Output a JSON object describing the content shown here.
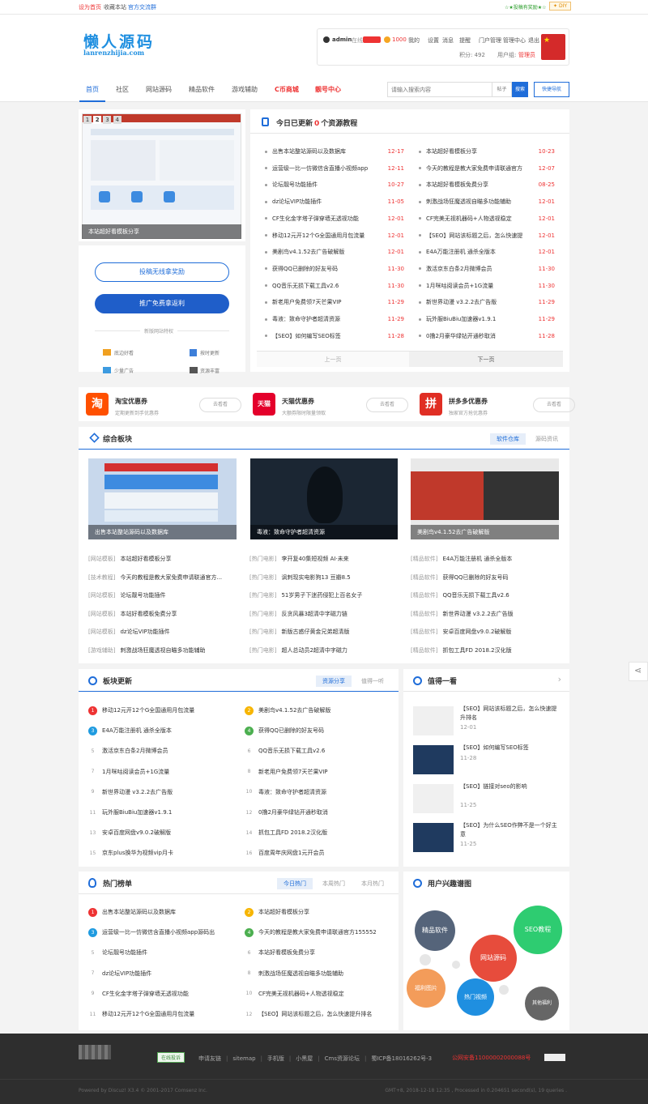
{
  "topbar": {
    "set_home": "设为首页",
    "bookmark": "收藏本站",
    "qq_group": "官方交流群",
    "right_link": "☆★投稿有奖励★☆",
    "diy": "DIY"
  },
  "logo": {
    "text": "懒人源码",
    "domain": "lanrenzhijia.com"
  },
  "user": {
    "name": "admin",
    "status": "在线",
    "points_label": "1000",
    "mine": "我的",
    "settings": "设置",
    "message": "消息",
    "remind": "提醒",
    "portal": "门户管理",
    "admin": "管理中心",
    "logout": "退出",
    "score": "积分: 492",
    "group_label": "用户组:",
    "group": "管理员"
  },
  "nav": {
    "items": [
      "首页",
      "社区",
      "网站源码",
      "精品软件",
      "游戏辅助",
      "C币商城",
      "靓号中心"
    ],
    "search_placeholder": "请输入搜索内容",
    "search_type": "帖子",
    "search_btn": "搜索",
    "quick_nav": "快捷导航"
  },
  "slider": {
    "pages": [
      "1",
      "2",
      "3",
      "4"
    ],
    "caption": "本站超好看模板分享"
  },
  "promo": {
    "btn1": "投稿无线拿奖励",
    "btn2": "推广免费拿返利",
    "features_title": "新版网站特权",
    "features": [
      "底边好看",
      "按时更新",
      "少量广告",
      "资源丰富"
    ]
  },
  "today": {
    "title_pre": "今日已更新",
    "count": "0",
    "title_post": "个资源教程",
    "prev": "上一页",
    "next": "下一页",
    "left": [
      [
        "出售本站整站源码以及数据库",
        "12-17"
      ],
      [
        "运营级一比一仿微信含直播小视频app",
        "12-11"
      ],
      [
        "论坛靓号功能插件",
        "10-27"
      ],
      [
        "dz论坛VIP功能插件",
        "11-05"
      ],
      [
        "CF生化金字塔子弹穿墙无透视功能",
        "12-01"
      ],
      [
        "移动12元开12个G全国通用月包流量",
        "12-01"
      ],
      [
        "美剧鸟v4.1.52去广告破解版",
        "12-01"
      ],
      [
        "获得QQ已删除的好友号码",
        "11-30"
      ],
      [
        "QQ音乐无损下载工具v2.6",
        "11-30"
      ],
      [
        "新老用户免费领7天芒果VIP",
        "11-29"
      ],
      [
        "毒液：致命守护者超清资源",
        "11-29"
      ],
      [
        "【SEO】如何编写SEO标签",
        "11-28"
      ]
    ],
    "right": [
      [
        "本站超好看模板分享",
        "10-23"
      ],
      [
        "今天的教程是教大家免费申请联通官方",
        "12-07"
      ],
      [
        "本站超好看模板免费分享",
        "08-25"
      ],
      [
        "刺激战场狂魔透视自瞄多功能辅助",
        "12-01"
      ],
      [
        "CF完美无视机器码+人物透视稳定",
        "12-01"
      ],
      [
        "【SEO】网站该标题之后，怎么快速提",
        "12-01"
      ],
      [
        "E4A万能注册机 通杀全版本",
        "12-01"
      ],
      [
        "激活京东白条2月微博会员",
        "11-30"
      ],
      [
        "1月咪咕阅读会员+1G流量",
        "11-30"
      ],
      [
        "新世界动漫 v3.2.2去广告版",
        "11-29"
      ],
      [
        "玩外服BiuBiu加速器v1.9.1",
        "11-29"
      ],
      [
        "0撸2月豪华绿钻开通秒取消",
        "11-28"
      ]
    ]
  },
  "coupons": [
    {
      "icon": "淘",
      "name": "淘宝优惠券",
      "sub": "定期更新到手优惠券",
      "btn": "去看看",
      "color": "#ff5000"
    },
    {
      "icon": "天猫",
      "name": "天猫优惠券",
      "sub": "大额券限时限量领取",
      "btn": "去看看",
      "color": "#e4002b"
    },
    {
      "icon": "拼",
      "name": "拼多多优惠券",
      "sub": "独家官方抢优惠券",
      "btn": "去看看",
      "color": "#e02e24"
    }
  ],
  "comp": {
    "title": "综合板块",
    "tabs": [
      "软件仓库",
      "源码资讯"
    ],
    "thumbs": [
      "出售本站整站源码以及数据库",
      "毒液：致命守护者超清资源",
      "美剧鸟v4.1.52去广告破解版"
    ],
    "cols": [
      [
        [
          "[网站模板]",
          "本站超好看模板分享"
        ],
        [
          "[技术教程]",
          "今天的教程是教大家免费申请联通官方..."
        ],
        [
          "[网站模板]",
          "论坛靓号功能插件"
        ],
        [
          "[网站模板]",
          "本站好看模板免费分享"
        ],
        [
          "[网站模板]",
          "dz论坛VIP功能插件"
        ],
        [
          "[游戏辅助]",
          "刺激战场狂魔透视自瞄多功能辅助"
        ]
      ],
      [
        [
          "[热门电影]",
          "李开复40集短视频 AI·未来"
        ],
        [
          "[热门电影]",
          "讽刺现实电影狗13 豆瓣8.5"
        ],
        [
          "[热门电影]",
          "51岁男子下迷药侵犯上百名女子"
        ],
        [
          "[热门电影]",
          "反贪风暴3超清中字磁力链"
        ],
        [
          "[热门电影]",
          "新版古惑仔黄金兄弟超清版"
        ],
        [
          "[热门电影]",
          "超人总动员2超清中字磁力"
        ]
      ],
      [
        [
          "[精品软件]",
          "E4A万能注册机 通杀全版本"
        ],
        [
          "[精品软件]",
          "获得QQ已删除的好友号码"
        ],
        [
          "[精品软件]",
          "QQ音乐无损下载工具v2.6"
        ],
        [
          "[精品软件]",
          "新世界动漫 v3.2.2去广告版"
        ],
        [
          "[精品软件]",
          "安卓百度网盘v9.0.2破解版"
        ],
        [
          "[精品软件]",
          "抓包工具FD 2018.2汉化版"
        ]
      ]
    ]
  },
  "board": {
    "title": "板块更新",
    "tabs": [
      "资源分享",
      "值得一听"
    ],
    "items": [
      "移动12元开12个G全国通用月包流量",
      "美剧鸟v4.1.52去广告破解版",
      "E4A万能注册机 通杀全版本",
      "获得QQ已删除的好友号码",
      "激活京东白条2月微博会员",
      "QQ音乐无损下载工具v2.6",
      "1月咪咕阅读会员+1G流量",
      "新老用户免费领7天芒果VIP",
      "新世界动漫 v3.2.2去广告版",
      "毒液：致命守护者超清资源",
      "玩外服BiuBiu加速器v1.9.1",
      "0撸2月豪华绿钻开通秒取消",
      "安卓百度网盘v9.0.2破解版",
      "抓包工具FD 2018.2汉化版",
      "京东plus换华为视频vip月卡",
      "百度周年庆网盘1元开会员"
    ]
  },
  "worth": {
    "title": "值得一看",
    "items": [
      [
        "【SEO】网站该标题之后，怎么快速提升排名",
        "12-01"
      ],
      [
        "【SEO】如何编写SEO标签",
        "11-28"
      ],
      [
        "【SEO】链接对seo的影响",
        "11-25"
      ],
      [
        "【SEO】为什么SEO作弊不是一个好主意",
        "11-25"
      ]
    ]
  },
  "hot": {
    "title": "热门榜单",
    "tabs": [
      "今日热门",
      "本周热门",
      "本月热门"
    ],
    "items": [
      "出售本站整站源码以及数据库",
      "本站超好看模板分享",
      "运营级一比一仿微信含直播小视频app源码出",
      "今天的教程是教大家免费申请联通官方155552",
      "论坛靓号功能插件",
      "本站好看模板免费分享",
      "dz论坛VIP功能插件",
      "刺激战场狂魔透视自瞄多功能辅助",
      "CF生化金字塔子弹穿墙无透视功能",
      "CF完美无视机器码+人物透视稳定",
      "移动12元开12个G全国通用月包流量",
      "【SEO】网站该标题之后，怎么快速提升排名"
    ]
  },
  "interest": {
    "title": "用户兴趣谱图",
    "bubbles": [
      "精品软件",
      "SEO教程",
      "网站源码",
      "福利图片",
      "热门视频",
      "其他福利"
    ]
  },
  "footer": {
    "badge": "在线投诉",
    "links": [
      "申请友链",
      "sitemap",
      "手机版",
      "小黑屋",
      "Cms资源论坛",
      "蜀ICP备18016262号-3"
    ],
    "police": "公网安备11000002000088号",
    "powered": "Powered by Discuz! X3.4 © 2001-2017 Comsenz Inc.",
    "time": "GMT+8, 2018-12-18 12:35 , Processed in 0.204651 second(s), 19 queries ."
  }
}
